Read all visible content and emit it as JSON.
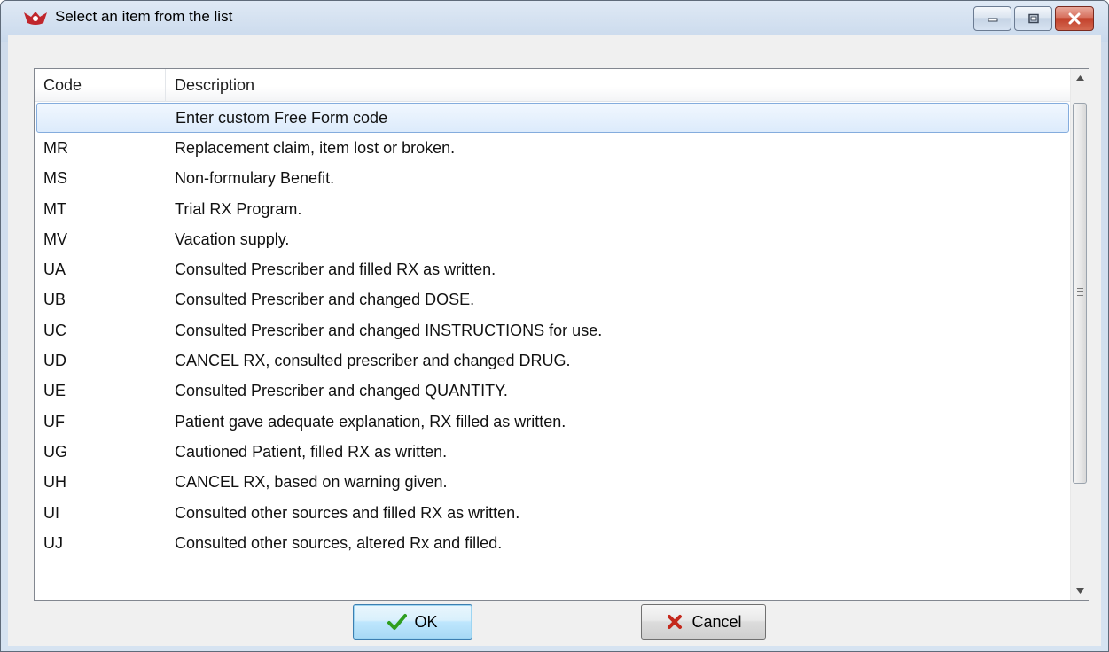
{
  "window": {
    "title": "Select an item from the list",
    "controls": {
      "minimize": "minimize-icon",
      "maximize": "maximize-icon",
      "close": "close-icon"
    }
  },
  "list": {
    "columns": {
      "code": "Code",
      "description": "Description"
    },
    "rows": [
      {
        "code": "",
        "description": "Enter custom Free Form code",
        "selected": true
      },
      {
        "code": "MR",
        "description": "Replacement claim, item lost or broken."
      },
      {
        "code": "MS",
        "description": "Non-formulary Benefit."
      },
      {
        "code": "MT",
        "description": "Trial RX Program."
      },
      {
        "code": "MV",
        "description": "Vacation supply."
      },
      {
        "code": "UA",
        "description": "Consulted Prescriber and filled RX as written."
      },
      {
        "code": "UB",
        "description": "Consulted Prescriber and changed DOSE."
      },
      {
        "code": "UC",
        "description": "Consulted Prescriber and changed INSTRUCTIONS for use."
      },
      {
        "code": "UD",
        "description": "CANCEL RX, consulted prescriber and changed DRUG."
      },
      {
        "code": "UE",
        "description": "Consulted Prescriber and changed QUANTITY."
      },
      {
        "code": "UF",
        "description": "Patient gave adequate explanation, RX filled as written."
      },
      {
        "code": "UG",
        "description": "Cautioned Patient, filled RX as written."
      },
      {
        "code": "UH",
        "description": "CANCEL RX, based on warning given."
      },
      {
        "code": "UI",
        "description": "Consulted other sources and filled RX as written."
      },
      {
        "code": "UJ",
        "description": "Consulted other sources, altered Rx and filled."
      }
    ]
  },
  "buttons": {
    "ok": {
      "label": "OK",
      "icon": "checkmark-icon",
      "color": "#2e9e1f"
    },
    "cancel": {
      "label": "Cancel",
      "icon": "x-icon",
      "color": "#c4281c"
    }
  },
  "colors": {
    "selection_border": "#84acdd",
    "selection_fill": "#dcebfc",
    "close_button": "#c2402a"
  }
}
